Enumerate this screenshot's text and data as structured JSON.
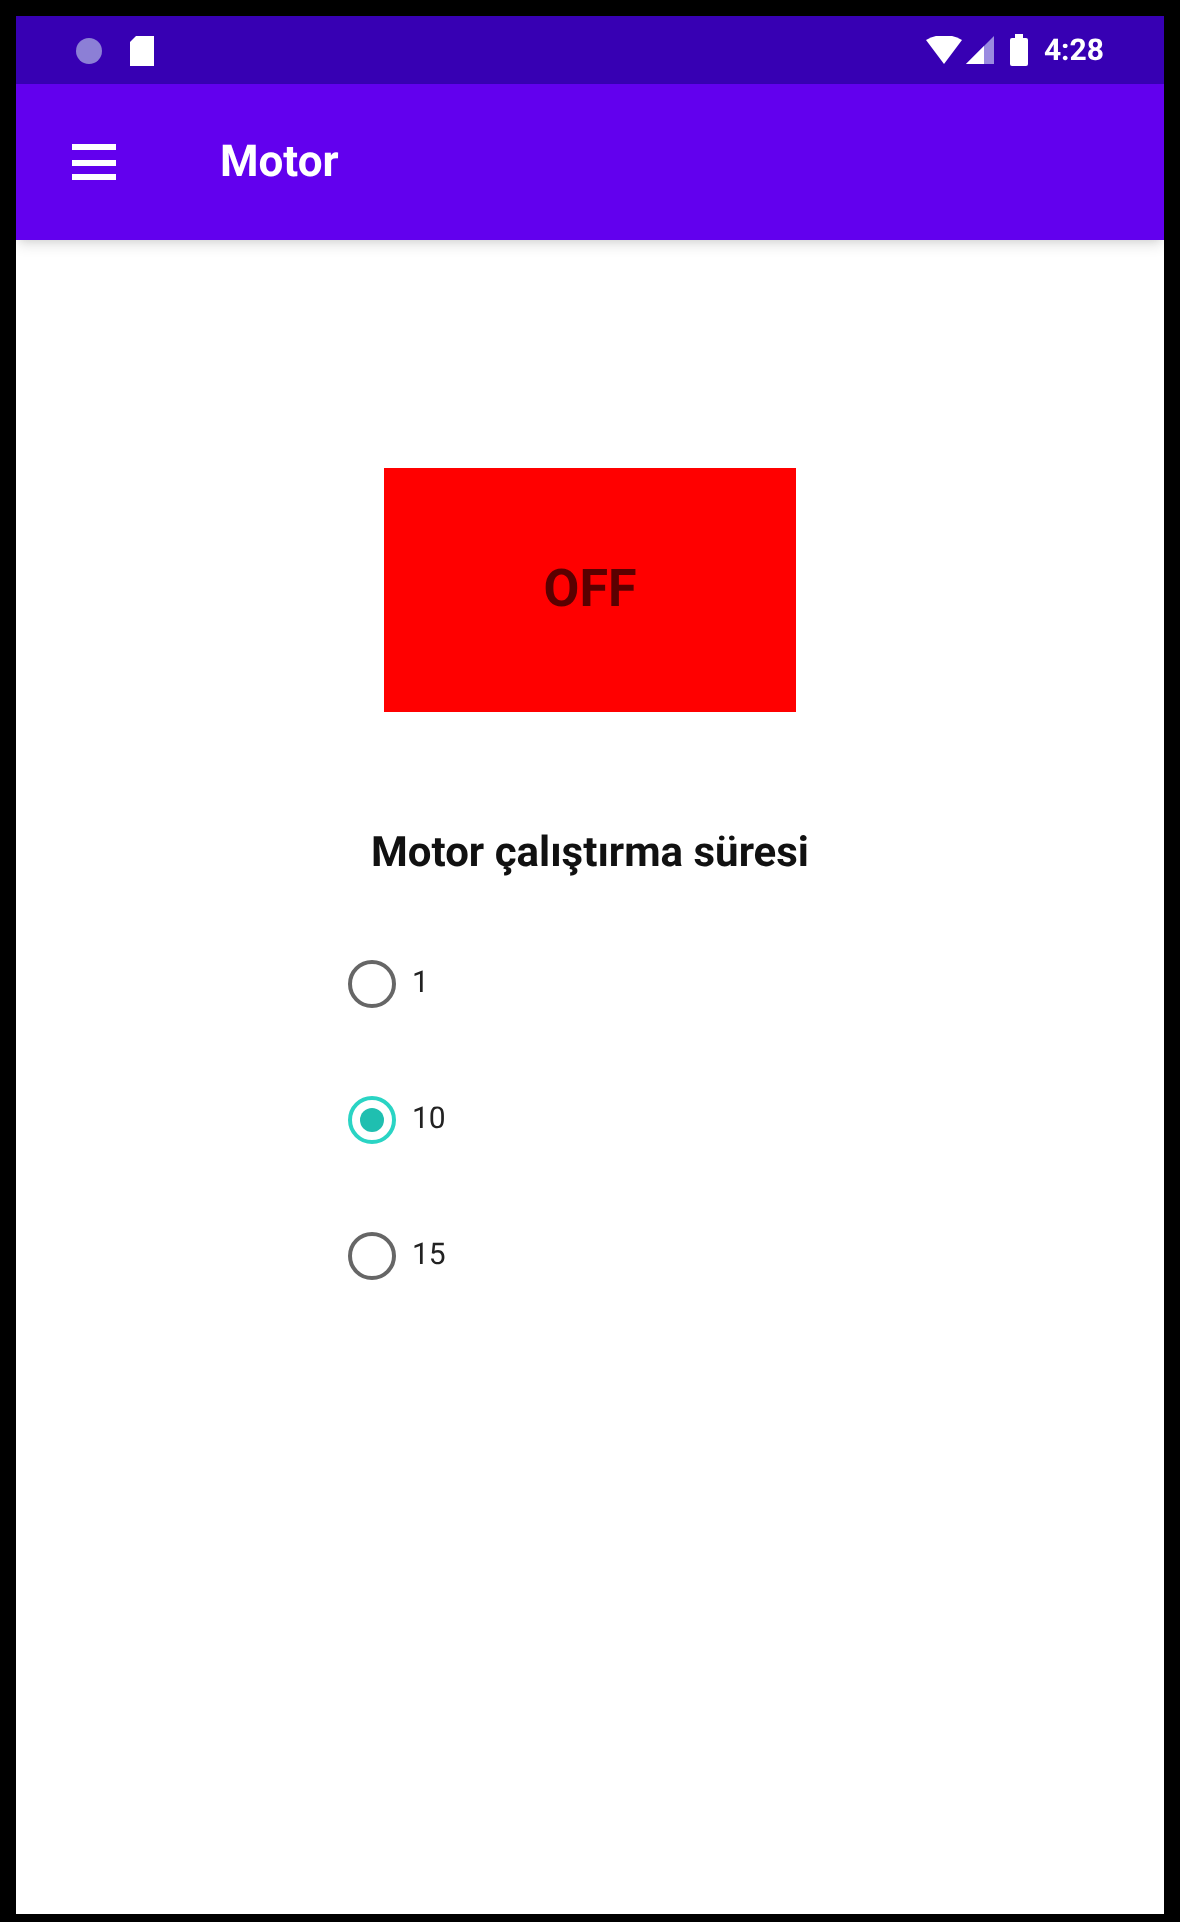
{
  "status_bar": {
    "time": "4:28"
  },
  "app_bar": {
    "title": "Motor"
  },
  "motor_button": {
    "label": "OFF",
    "on": false
  },
  "duration": {
    "title": "Motor çalıştırma süresi",
    "options": [
      {
        "label": "1",
        "selected": false
      },
      {
        "label": "10",
        "selected": true
      },
      {
        "label": "15",
        "selected": false
      }
    ]
  }
}
